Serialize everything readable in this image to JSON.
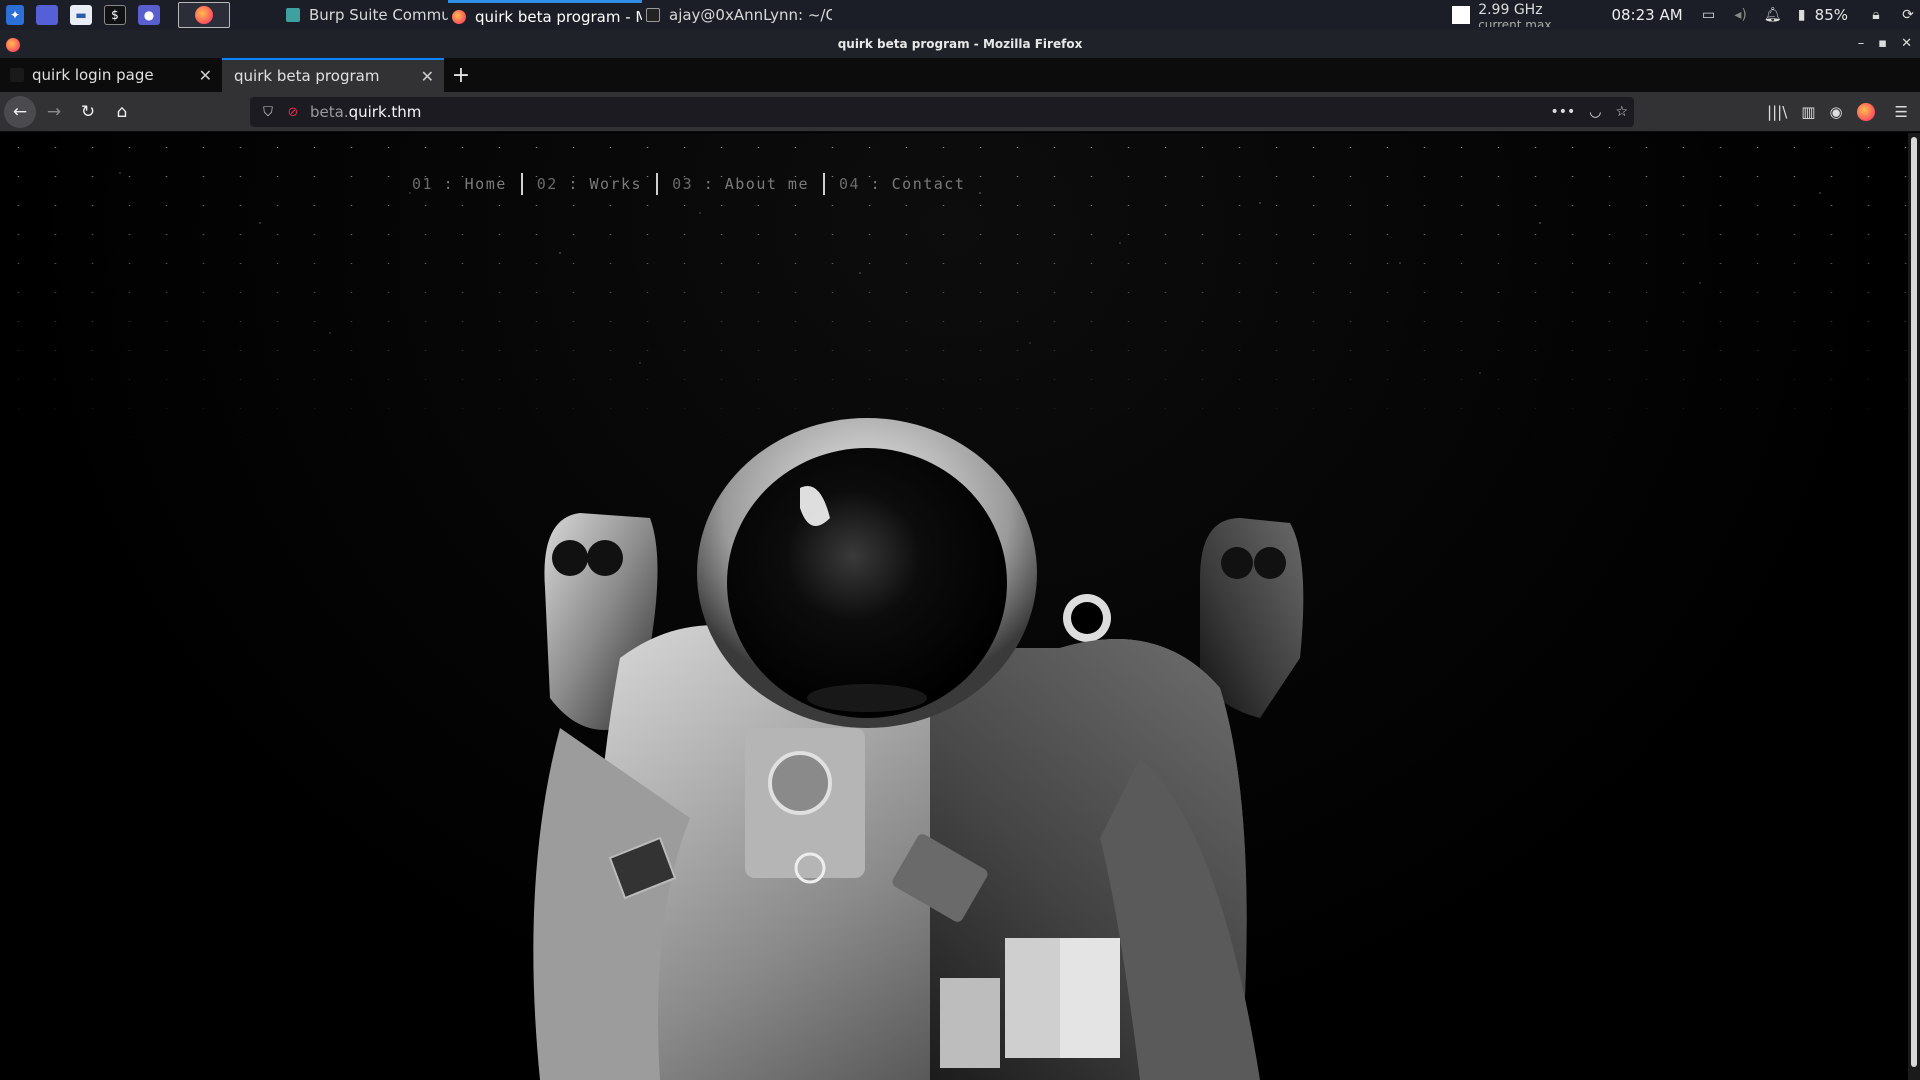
{
  "taskbar": {
    "tasks": [
      {
        "label": "Burp Suite Community E...",
        "icon": "burp-icon"
      },
      {
        "label": "quirk beta program - Mo...",
        "icon": "firefox-icon"
      },
      {
        "label": "ajay@0xAnnLynn: ~/CT...",
        "icon": "terminal-icon"
      }
    ],
    "cpu_freq": "2.99 GHz",
    "cpu_sub": "current max",
    "clock": "08:23 AM",
    "battery": "85%"
  },
  "window": {
    "title": "quirk beta program - Mozilla Firefox"
  },
  "tabs": [
    {
      "label": "quirk login page",
      "active": false
    },
    {
      "label": "quirk beta program",
      "active": true
    }
  ],
  "urlbar": {
    "subdomain": "beta.",
    "domain": "quirk.thm"
  },
  "site": {
    "nav": [
      {
        "num": "01",
        "sep": ":",
        "label": "Home"
      },
      {
        "num": "02",
        "sep": ":",
        "label": "Works"
      },
      {
        "num": "03",
        "sep": ":",
        "label": "About me"
      },
      {
        "num": "04",
        "sep": ":",
        "label": "Contact"
      }
    ]
  },
  "colors": {
    "tab_accent": "#0a84ff",
    "taskbar_accent": "#2f8fe6",
    "page_bg": "#000000"
  }
}
